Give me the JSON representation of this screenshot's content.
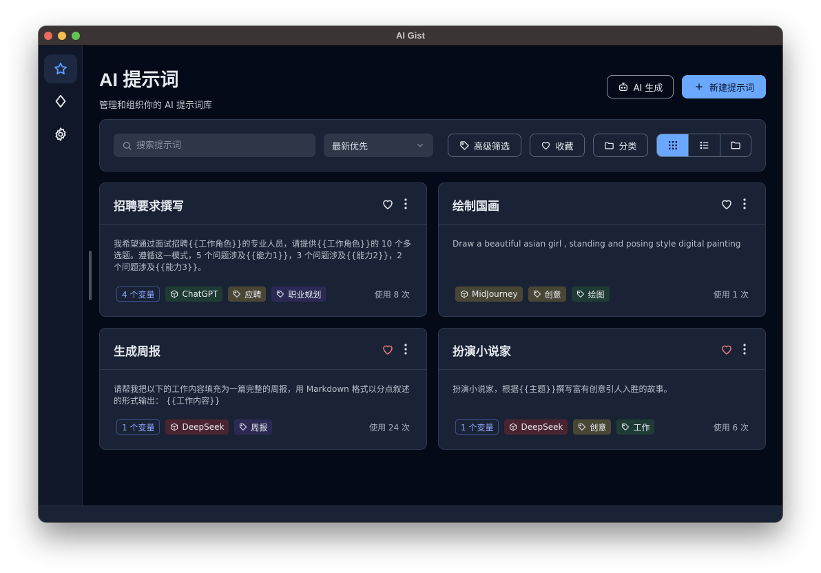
{
  "window": {
    "title": "AI Gist"
  },
  "sidebar": {
    "items": [
      {
        "icon": "star-icon",
        "active": true
      },
      {
        "icon": "diamond-icon",
        "active": false
      },
      {
        "icon": "gear-icon",
        "active": false
      }
    ]
  },
  "header": {
    "title": "AI 提示词",
    "subtitle": "管理和组织你的 AI 提示词库",
    "ai_button_label": "AI 生成",
    "new_button_label": "新建提示词"
  },
  "toolbar": {
    "search_placeholder": "搜索提示词",
    "search_value": "",
    "sort_selected": "最新优先",
    "filter_label": "高级筛选",
    "favorites_label": "收藏",
    "category_label": "分类",
    "view_modes": [
      "grid",
      "list",
      "folder"
    ],
    "active_view": "grid"
  },
  "colors": {
    "accent": "#6aa8ff",
    "favorite_active": "#f07878",
    "variable_tag": "#8fa5ff"
  },
  "cards": [
    {
      "title": "招聘要求撰写",
      "favorited": false,
      "content": "我希望通过面试招聘{{工作角色}}的专业人员，请提供{{工作角色}}的 10 个多选题。遵循这一模式，5 个问题涉及{{能力1}}，3 个问题涉及{{能力2}}，2 个问题涉及{{能力3}}。",
      "variables": "4 个变量",
      "model": "ChatGPT",
      "tags": [
        "应聘",
        "职业规划"
      ],
      "usage": "使用 8 次"
    },
    {
      "title": "绘制国画",
      "favorited": false,
      "content": "Draw a beautiful asian girl , standing and posing style digital painting",
      "variables": "",
      "model": "MidJourney",
      "tags": [
        "创意",
        "绘图"
      ],
      "usage": "使用 1 次"
    },
    {
      "title": "生成周报",
      "favorited": true,
      "content": "请帮我把以下的工作内容填充为一篇完整的周报，用 Markdown 格式以分点叙述的形式输出：  {{工作内容}}",
      "variables": "1 个变量",
      "model": "DeepSeek",
      "tags": [
        "周报"
      ],
      "usage": "使用 24 次"
    },
    {
      "title": "扮演小说家",
      "favorited": true,
      "content": "扮演小说家，根据{{主题}}撰写富有创意引人入胜的故事。",
      "variables": "1 个变量",
      "model": "DeepSeek",
      "tags": [
        "创意",
        "工作"
      ],
      "usage": "使用 6 次"
    }
  ]
}
